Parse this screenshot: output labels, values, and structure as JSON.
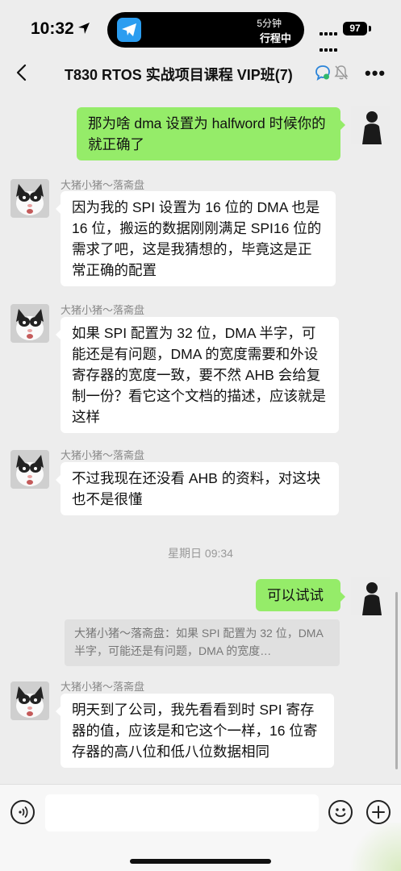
{
  "status_bar": {
    "time": "10:32",
    "island_line1": "5分钟",
    "island_line2": "行程中",
    "battery": "97"
  },
  "header": {
    "title": "T830 RTOS 实战项目课程 VIP班(7)"
  },
  "messages": [
    {
      "side": "right",
      "sender": "",
      "text": "那为啥 dma 设置为 halfword 时候你的就正确了"
    },
    {
      "side": "left",
      "sender": "大猪小猪～落斋盘",
      "text": "因为我的 SPI 设置为 16 位的 DMA 也是 16 位，搬运的数据刚刚满足 SPI16 位的需求了吧，这是我猜想的，毕竟这是正常正确的配置"
    },
    {
      "side": "left",
      "sender": "大猪小猪～落斋盘",
      "text": "如果 SPI 配置为 32 位，DMA 半字，可能还是有问题，DMA 的宽度需要和外设寄存器的宽度一致，要不然 AHB 会给复制一份？看它这个文档的描述，应该就是这样"
    },
    {
      "side": "left",
      "sender": "大猪小猪～落斋盘",
      "text": "不过我现在还没看 AHB 的资料，对这块也不是很懂"
    },
    {
      "side": "right",
      "sender": "",
      "text": "可以试试"
    },
    {
      "side": "left",
      "sender": "大猪小猪～落斋盘",
      "text": "明天到了公司，我先看看到时 SPI 寄存器的值，应该是和它这个一样，16 位寄存器的高八位和低八位数据相同"
    }
  ],
  "timestamp": "星期日 09:34",
  "quote": "大猪小猪～落斋盘：如果 SPI 配置为 32 位，DMA 半字，可能还是有问题，DMA 的宽度…",
  "colors": {
    "background": "#ededed",
    "bubble_self": "#95ec69",
    "bubble_other": "#ffffff"
  }
}
